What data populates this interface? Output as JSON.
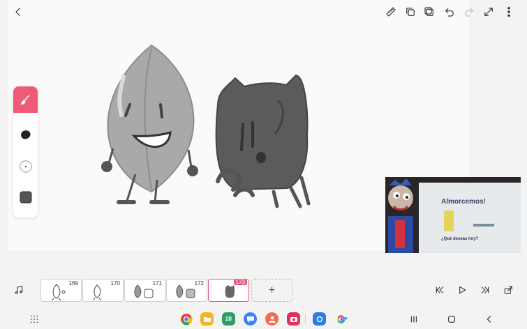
{
  "frames": [
    {
      "number": "169"
    },
    {
      "number": "170"
    },
    {
      "number": "171"
    },
    {
      "number": "172"
    },
    {
      "number": "173"
    }
  ],
  "add_frame_label": "+",
  "calendar_app_label": "28",
  "pip": {
    "headline": "Almorcemos!",
    "question": "¿Qué deseas hoy?"
  },
  "colors": {
    "accent": "#e8587a",
    "brush_tool": "#ef5a78"
  }
}
